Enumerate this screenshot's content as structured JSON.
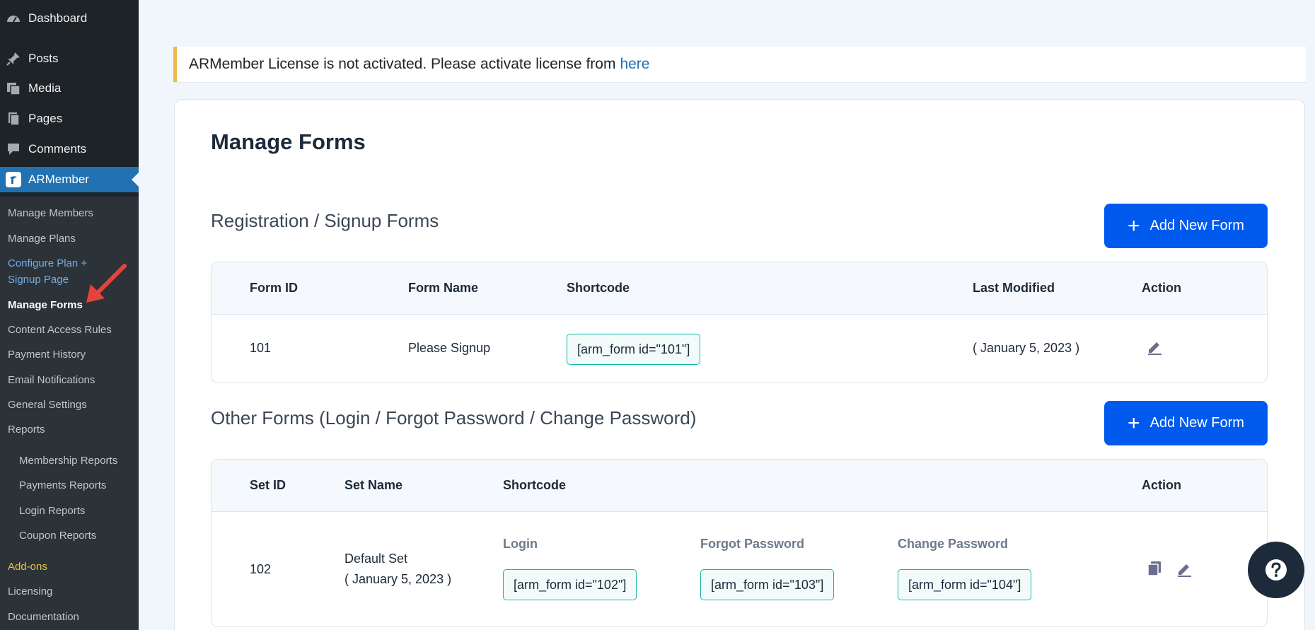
{
  "sidebar": {
    "menu": [
      {
        "label": "Dashboard",
        "icon": "dashboard-icon"
      },
      {
        "label": "Posts",
        "icon": "pin-icon"
      },
      {
        "label": "Media",
        "icon": "media-icon"
      },
      {
        "label": "Pages",
        "icon": "pages-icon"
      },
      {
        "label": "Comments",
        "icon": "comment-icon"
      },
      {
        "label": "ARMember",
        "icon": "armember-icon"
      }
    ],
    "submenu": [
      "Manage Members",
      "Manage Plans",
      "Configure Plan +",
      "Signup Page",
      "Manage Forms",
      "Content Access Rules",
      "Payment History",
      "Email Notifications",
      "General Settings",
      "Reports",
      "Membership Reports",
      "Payments Reports",
      "Login Reports",
      "Coupon Reports",
      "Add-ons",
      "Licensing",
      "Documentation"
    ]
  },
  "notice": {
    "text": "ARMember License is not activated. Please activate license from",
    "link": "here"
  },
  "page_title": "Manage Forms",
  "registration": {
    "title": "Registration / Signup Forms",
    "button": "Add New Form",
    "headers": [
      "Form ID",
      "Form Name",
      "Shortcode",
      "Last Modified",
      "Action"
    ],
    "row": {
      "id": "101",
      "name": "Please Signup",
      "shortcode": "[arm_form id=\"101\"]",
      "modified": "( January 5, 2023 )"
    }
  },
  "other": {
    "title": "Other Forms (Login / Forgot Password / Change Password)",
    "button": "Add New Form",
    "headers": [
      "Set ID",
      "Set Name",
      "Shortcode",
      "Action"
    ],
    "row": {
      "id": "102",
      "name": "Default Set",
      "date": "( January 5, 2023 )",
      "login_label": "Login",
      "login_code": "[arm_form id=\"102\"]",
      "forgot_label": "Forgot Password",
      "forgot_code": "[arm_form id=\"103\"]",
      "change_label": "Change Password",
      "change_code": "[arm_form id=\"104\"]"
    }
  },
  "colors": {
    "accent": "#005aee",
    "sidebar": "#1d2327",
    "active_menu": "#2271b1",
    "arrow": "#e8433a",
    "shortcode_border": "#14b8a6"
  }
}
